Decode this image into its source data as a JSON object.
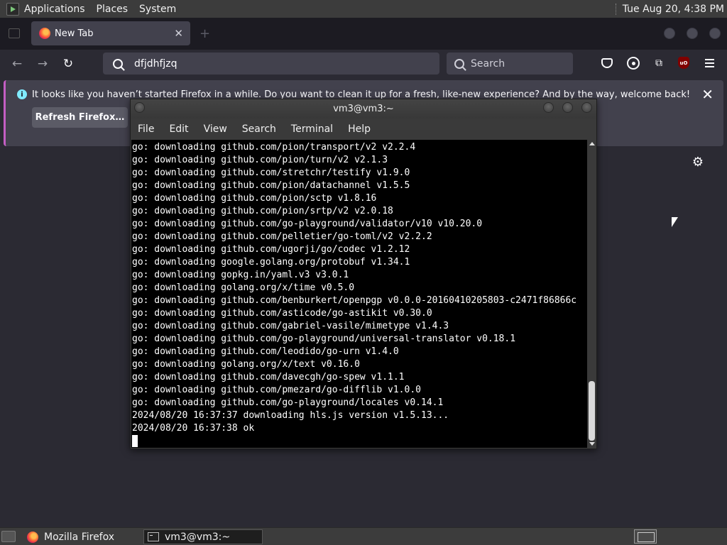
{
  "top_panel": {
    "menus": [
      "Applications",
      "Places",
      "System"
    ],
    "clock": "Tue Aug 20,  4:38 PM"
  },
  "firefox": {
    "tab_title": "New Tab",
    "tab_close": "✕",
    "new_tab": "+",
    "url": "dfjdhfjzq",
    "search_placeholder": "Search",
    "notification": {
      "text": "It looks like you haven’t started Firefox in a while. Do you want to clean it up for a fresh, like-new experience? And by the way, welcome back!",
      "button": "Refresh Firefox…",
      "close": "✕"
    },
    "icons": [
      "back-arrow-icon",
      "forward-arrow-icon",
      "reload-icon",
      "search-icon",
      "pocket-icon",
      "account-icon",
      "extensions-icon",
      "ublock-origin-icon",
      "hamburger-menu-icon",
      "gear-icon"
    ]
  },
  "terminal": {
    "title": "vm3@vm3:~",
    "menus": [
      "File",
      "Edit",
      "View",
      "Search",
      "Terminal",
      "Help"
    ],
    "lines": [
      "go: downloading github.com/pion/transport/v2 v2.2.4",
      "go: downloading github.com/pion/turn/v2 v2.1.3",
      "go: downloading github.com/stretchr/testify v1.9.0",
      "go: downloading github.com/pion/datachannel v1.5.5",
      "go: downloading github.com/pion/sctp v1.8.16",
      "go: downloading github.com/pion/srtp/v2 v2.0.18",
      "go: downloading github.com/go-playground/validator/v10 v10.20.0",
      "go: downloading github.com/pelletier/go-toml/v2 v2.2.2",
      "go: downloading github.com/ugorji/go/codec v1.2.12",
      "go: downloading google.golang.org/protobuf v1.34.1",
      "go: downloading gopkg.in/yaml.v3 v3.0.1",
      "go: downloading golang.org/x/time v0.5.0",
      "go: downloading github.com/benburkert/openpgp v0.0.0-20160410205803-c2471f86866c",
      "go: downloading github.com/asticode/go-astikit v0.30.0",
      "go: downloading github.com/gabriel-vasile/mimetype v1.4.3",
      "go: downloading github.com/go-playground/universal-translator v0.18.1",
      "go: downloading github.com/leodido/go-urn v1.4.0",
      "go: downloading golang.org/x/text v0.16.0",
      "go: downloading github.com/davecgh/go-spew v1.1.1",
      "go: downloading github.com/pmezard/go-difflib v1.0.0",
      "go: downloading github.com/go-playground/locales v0.14.1",
      "2024/08/20 16:37:37 downloading hls.js version v1.5.13...",
      "2024/08/20 16:37:38 ok"
    ]
  },
  "taskbar": {
    "tasks": [
      "Mozilla Firefox",
      "vm3@vm3:~"
    ]
  },
  "colors": {
    "ff_bg": "#2b2a33",
    "ff_tabbar": "#1c1b22",
    "notif_accent": "#c45ec4",
    "panel": "#3c3c3c",
    "terminal_bg": "#000000"
  }
}
